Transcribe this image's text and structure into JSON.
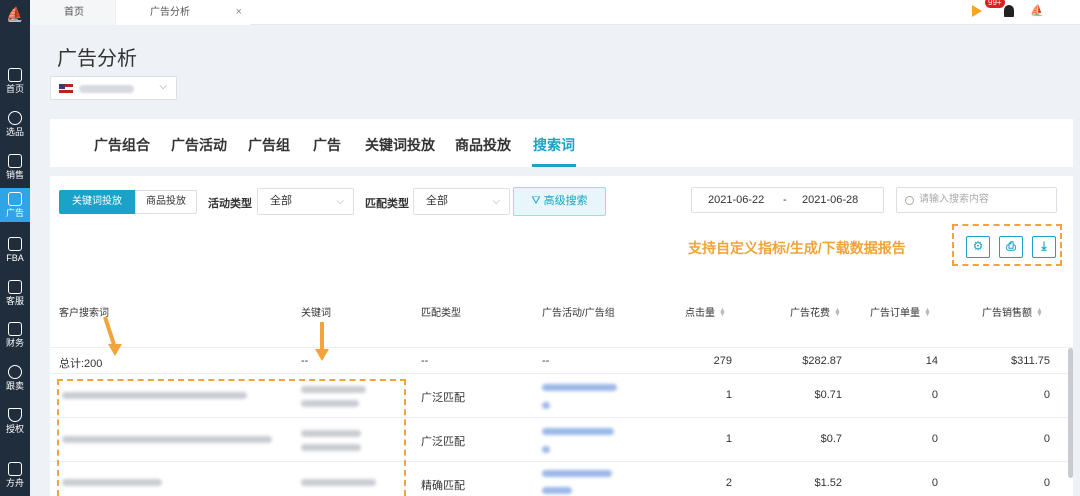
{
  "sidebar": {
    "items": [
      {
        "label": "首页",
        "icon": "home-icon"
      },
      {
        "label": "选品",
        "icon": "search-icon"
      },
      {
        "label": "销售",
        "icon": "chart-icon"
      },
      {
        "label": "广告",
        "icon": "ad-icon"
      },
      {
        "label": "FBA",
        "icon": "fba-icon"
      },
      {
        "label": "客服",
        "icon": "message-icon"
      },
      {
        "label": "财务",
        "icon": "finance-icon"
      },
      {
        "label": "跟卖",
        "icon": "pie-icon"
      },
      {
        "label": "授权",
        "icon": "shield-icon"
      },
      {
        "label": "方舟",
        "icon": "ark-icon"
      }
    ]
  },
  "tabs": [
    {
      "label": "首页"
    },
    {
      "label": "广告分析",
      "close": "×"
    }
  ],
  "topbar": {
    "badge": "99+"
  },
  "page": {
    "title": "广告分析"
  },
  "nav": {
    "tabs": [
      "广告组合",
      "广告活动",
      "广告组",
      "广告",
      "关键词投放",
      "商品投放",
      "搜索词"
    ],
    "active": "搜索词"
  },
  "filters": {
    "segment": [
      "关键词投放",
      "商品投放"
    ],
    "campaign_type_label": "活动类型",
    "campaign_type_value": "全部",
    "match_type_label": "匹配类型",
    "match_type_value": "全部",
    "advanced_search": "高级搜索",
    "date_start": "2021-06-22",
    "date_sep": "-",
    "date_end": "2021-06-28",
    "search_placeholder": "请输入搜索内容"
  },
  "promo_text": "支持自定义指标/生成/下载数据报告",
  "toolbar": [
    "settings-icon",
    "print-icon",
    "download-icon"
  ],
  "table": {
    "headers": [
      "客户搜索词",
      "关键词",
      "匹配类型",
      "广告活动/广告组",
      "点击量",
      "广告花费",
      "广告订单量",
      "广告销售额"
    ],
    "total": {
      "label": "总计:200",
      "keyword": "--",
      "match": "--",
      "campaign": "--",
      "clicks": "279",
      "spend": "$282.87",
      "orders": "14",
      "sales": "$311.75"
    },
    "rows": [
      {
        "match": "广泛匹配",
        "clicks": "1",
        "spend": "$0.71",
        "orders": "0",
        "sales": "0"
      },
      {
        "match": "广泛匹配",
        "clicks": "1",
        "spend": "$0.7",
        "orders": "0",
        "sales": "0"
      },
      {
        "match": "精确匹配",
        "clicks": "2",
        "spend": "$1.52",
        "orders": "0",
        "sales": "0"
      }
    ]
  },
  "colors": {
    "accent": "#1aa3c8",
    "annotation": "#f0a43a",
    "sidebar": "#1f2d3d"
  }
}
